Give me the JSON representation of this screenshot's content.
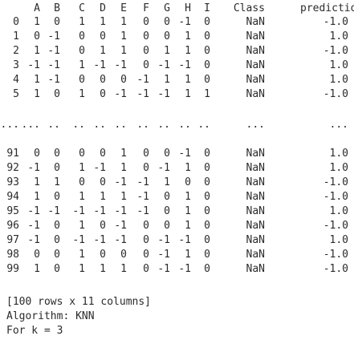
{
  "columns": [
    "",
    "A",
    "B",
    "C",
    "D",
    "E",
    "F",
    "G",
    "H",
    "I",
    "Class",
    "prediction"
  ],
  "rows": [
    [
      "0",
      "1",
      "0",
      "1",
      "1",
      "1",
      "0",
      "0",
      "-1",
      "0",
      "NaN",
      "-1.0"
    ],
    [
      "1",
      "0",
      "-1",
      "0",
      "0",
      "1",
      "0",
      "0",
      "1",
      "0",
      "NaN",
      "1.0"
    ],
    [
      "2",
      "1",
      "-1",
      "0",
      "1",
      "1",
      "0",
      "1",
      "1",
      "0",
      "NaN",
      "-1.0"
    ],
    [
      "3",
      "-1",
      "-1",
      "1",
      "-1",
      "-1",
      "0",
      "-1",
      "-1",
      "0",
      "NaN",
      "1.0"
    ],
    [
      "4",
      "1",
      "-1",
      "0",
      "0",
      "0",
      "-1",
      "1",
      "1",
      "0",
      "NaN",
      "1.0"
    ],
    [
      "5",
      "1",
      "0",
      "1",
      "0",
      "-1",
      "-1",
      "-1",
      "1",
      "1",
      "NaN",
      "-1.0"
    ],
    [
      "...",
      "...",
      "..",
      "..",
      "..",
      "..",
      "..",
      "..",
      "..",
      "..",
      "...",
      "..."
    ],
    [
      "91",
      "0",
      "0",
      "0",
      "0",
      "1",
      "0",
      "0",
      "-1",
      "0",
      "NaN",
      "1.0"
    ],
    [
      "92",
      "-1",
      "0",
      "1",
      "-1",
      "1",
      "0",
      "-1",
      "1",
      "0",
      "NaN",
      "1.0"
    ],
    [
      "93",
      "1",
      "1",
      "0",
      "0",
      "-1",
      "-1",
      "1",
      "0",
      "0",
      "NaN",
      "-1.0"
    ],
    [
      "94",
      "1",
      "0",
      "1",
      "1",
      "1",
      "-1",
      "0",
      "1",
      "0",
      "NaN",
      "-1.0"
    ],
    [
      "95",
      "-1",
      "-1",
      "-1",
      "-1",
      "-1",
      "-1",
      "0",
      "1",
      "0",
      "NaN",
      "1.0"
    ],
    [
      "96",
      "-1",
      "0",
      "1",
      "0",
      "-1",
      "0",
      "0",
      "1",
      "0",
      "NaN",
      "-1.0"
    ],
    [
      "97",
      "-1",
      "0",
      "-1",
      "-1",
      "-1",
      "0",
      "-1",
      "-1",
      "0",
      "NaN",
      "1.0"
    ],
    [
      "98",
      "0",
      "0",
      "1",
      "0",
      "0",
      "0",
      "-1",
      "1",
      "0",
      "NaN",
      "-1.0"
    ],
    [
      "99",
      "1",
      "0",
      "1",
      "1",
      "1",
      "0",
      "-1",
      "-1",
      "0",
      "NaN",
      "-1.0"
    ]
  ],
  "footer": {
    "shape_line": "[100 rows x 11 columns]",
    "algorithm_line": "Algorithm: KNN",
    "k_line": "For k = 3"
  }
}
